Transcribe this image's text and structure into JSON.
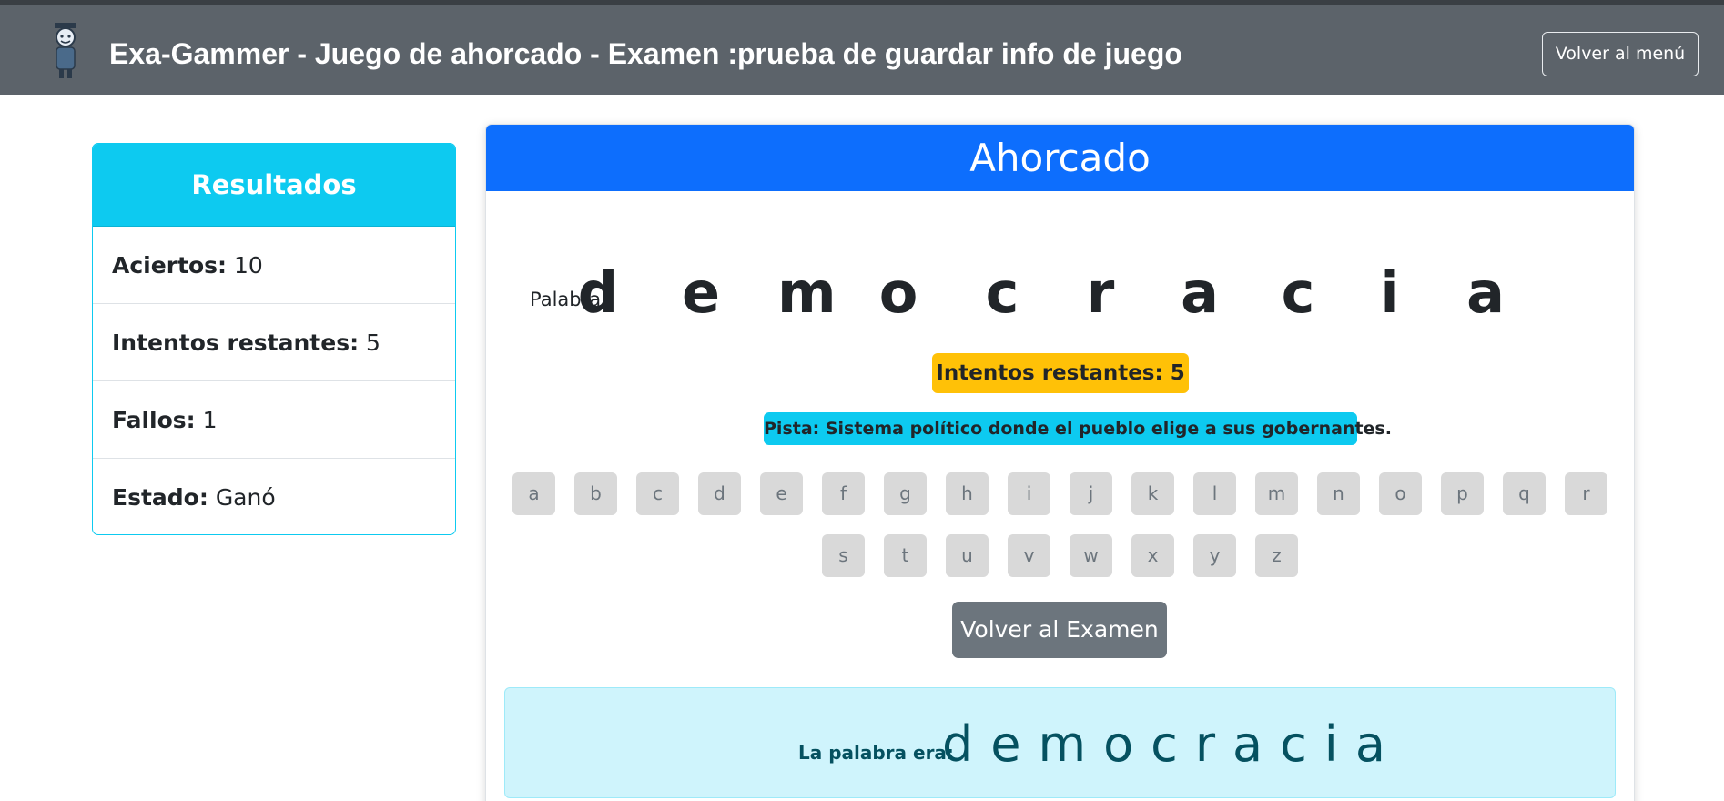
{
  "header": {
    "title": "Exa-Gammer - Juego de ahorcado - Examen :prueba de guardar info de juego",
    "menu_button": "Volver al menú",
    "logo_icon": "student-avatar-icon"
  },
  "results": {
    "title": "Resultados",
    "rows": [
      {
        "label": "Aciertos:",
        "value": "10"
      },
      {
        "label": "Intentos restantes:",
        "value": "5"
      },
      {
        "label": "Fallos:",
        "value": "1"
      },
      {
        "label": "Estado:",
        "value": "Ganó"
      }
    ]
  },
  "game": {
    "title": "Ahorcado",
    "word_label": "Palabra:",
    "word_letters": [
      "d",
      "e",
      "m",
      "o",
      "c",
      "r",
      "a",
      "c",
      "i",
      "a"
    ],
    "intentos_badge": "Intentos restantes: 5",
    "hint": "Pista: Sistema político donde el pueblo elige a sus gobernantes.",
    "keyboard_row1": [
      "a",
      "b",
      "c",
      "d",
      "e",
      "f",
      "g",
      "h",
      "i",
      "j",
      "k",
      "l",
      "m",
      "n",
      "o",
      "p",
      "q",
      "r"
    ],
    "keyboard_row2": [
      "s",
      "t",
      "u",
      "v",
      "w",
      "x",
      "y",
      "z"
    ],
    "back_button": "Volver al Examen",
    "answer_label": "La palabra era:",
    "answer_word": "democracia"
  },
  "colors": {
    "header_bg": "#5c636a",
    "info": "#0dcaf0",
    "primary": "#0d6efd",
    "warning": "#ffc107",
    "secondary": "#6c757d",
    "answer_bg": "#cff4fc",
    "answer_text": "#055160"
  }
}
